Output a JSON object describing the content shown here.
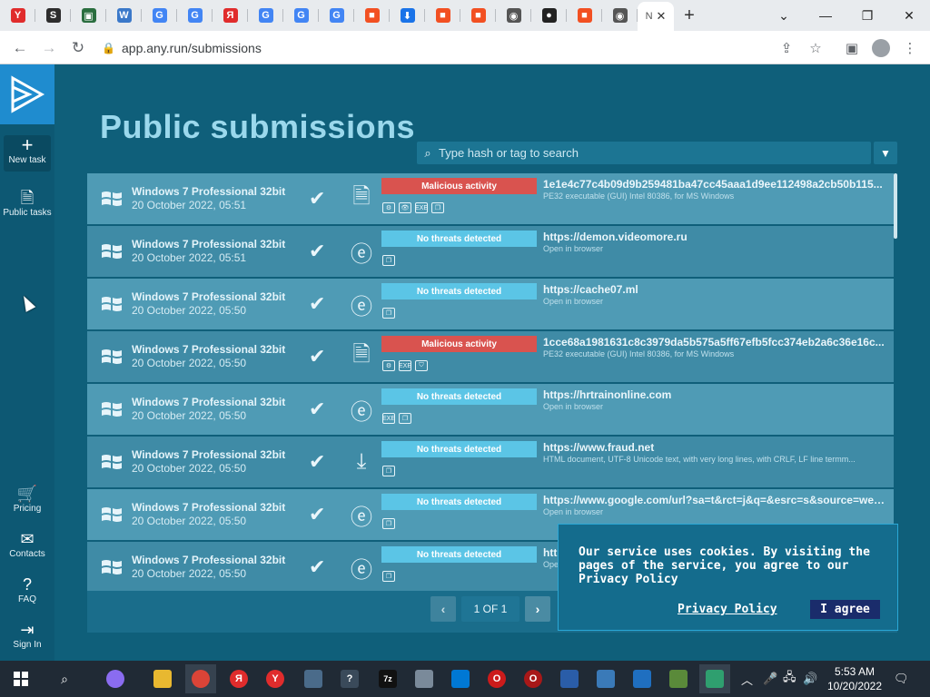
{
  "browser": {
    "tabs": [
      {
        "icon": "yandex-icon",
        "glyph": "Y",
        "color": "#e02c2c"
      },
      {
        "icon": "s-icon",
        "glyph": "S",
        "color": "#2d2d2d"
      },
      {
        "icon": "image-icon",
        "glyph": "▣",
        "color": "#2a6e3f"
      },
      {
        "icon": "wikipedia-icon",
        "glyph": "W",
        "color": "#3a78c9"
      },
      {
        "icon": "google-icon",
        "glyph": "G",
        "color": "#4285f4"
      },
      {
        "icon": "google-icon",
        "glyph": "G",
        "color": "#4285f4"
      },
      {
        "icon": "yandex-icon",
        "glyph": "Я",
        "color": "#e02c2c"
      },
      {
        "icon": "google-icon",
        "glyph": "G",
        "color": "#4285f4"
      },
      {
        "icon": "google-icon",
        "glyph": "G",
        "color": "#4285f4"
      },
      {
        "icon": "google-icon",
        "glyph": "G",
        "color": "#4285f4"
      },
      {
        "icon": "microsoft-icon",
        "glyph": "■",
        "color": "#f25022"
      },
      {
        "icon": "download-icon",
        "glyph": "⬇",
        "color": "#1a73e8"
      },
      {
        "icon": "microsoft-icon",
        "glyph": "■",
        "color": "#f25022"
      },
      {
        "icon": "microsoft-icon",
        "glyph": "■",
        "color": "#f25022"
      },
      {
        "icon": "chrome-icon",
        "glyph": "◉",
        "color": "#555"
      },
      {
        "icon": "github-icon",
        "glyph": "●",
        "color": "#222"
      },
      {
        "icon": "microsoft-icon",
        "glyph": "■",
        "color": "#f25022"
      },
      {
        "icon": "chrome-icon",
        "glyph": "◉",
        "color": "#555"
      }
    ],
    "active_tab_glyph": "N",
    "url": "app.any.run/submissions"
  },
  "sidebar": {
    "new_task": "New task",
    "public_tasks": "Public tasks",
    "pricing": "Pricing",
    "contacts": "Contacts",
    "faq": "FAQ",
    "sign_in": "Sign In"
  },
  "page": {
    "title": "Public submissions",
    "search_placeholder": "Type hash or tag to search"
  },
  "submissions": [
    {
      "os": "Windows 7 Professional 32bit",
      "date": "20 October 2022, 05:51",
      "type": "file",
      "verdict": "Malicious activity",
      "verdict_kind": "bad",
      "object": "1e1e4c77c4b09d9b259481ba47cc45aaa1d9ee112498a2cb50b115...",
      "detail": "PE32 executable (GUI) Intel 80386, for MS Windows",
      "tags": [
        "⚙",
        "👁",
        "EXE",
        "❐"
      ]
    },
    {
      "os": "Windows 7 Professional 32bit",
      "date": "20 October 2022, 05:51",
      "type": "ie",
      "verdict": "No threats detected",
      "verdict_kind": "good",
      "object": "https://demon.videomore.ru",
      "detail": "Open in browser",
      "tags": [
        "❐"
      ]
    },
    {
      "os": "Windows 7 Professional 32bit",
      "date": "20 October 2022, 05:50",
      "type": "ie",
      "verdict": "No threats detected",
      "verdict_kind": "good",
      "object": "https://cache07.ml",
      "detail": "Open in browser",
      "tags": [
        "❐"
      ]
    },
    {
      "os": "Windows 7 Professional 32bit",
      "date": "20 October 2022, 05:50",
      "type": "file",
      "verdict": "Malicious activity",
      "verdict_kind": "bad",
      "object": "1cce68a1981631c8c3979da5b575a5ff67efb5fcc374eb2a6c36e16c...",
      "detail": "PE32 executable (GUI) Intel 80386, for MS Windows",
      "tags": [
        "⚙",
        "EXE",
        "⛉"
      ]
    },
    {
      "os": "Windows 7 Professional 32bit",
      "date": "20 October 2022, 05:50",
      "type": "ie",
      "verdict": "No threats detected",
      "verdict_kind": "good",
      "object": "https://hrtrainonline.com",
      "detail": "Open in browser",
      "tags": [
        "EXE",
        "❐"
      ]
    },
    {
      "os": "Windows 7 Professional 32bit",
      "date": "20 October 2022, 05:50",
      "type": "download",
      "verdict": "No threats detected",
      "verdict_kind": "good",
      "object": "https://www.fraud.net",
      "detail": "HTML document, UTF-8 Unicode text, with very long lines, with CRLF, LF line termm...",
      "tags": [
        "❐"
      ]
    },
    {
      "os": "Windows 7 Professional 32bit",
      "date": "20 October 2022, 05:50",
      "type": "ie",
      "verdict": "No threats detected",
      "verdict_kind": "good",
      "object": "https://www.google.com/url?sa=t&rct=j&q=&esrc=s&source=web&c...",
      "detail": "Open in browser",
      "tags": [
        "❐"
      ]
    },
    {
      "os": "Windows 7 Professional 32bit",
      "date": "20 October 2022, 05:50",
      "type": "ie",
      "verdict": "No threats detected",
      "verdict_kind": "good",
      "object": "https://",
      "detail": "Ope",
      "tags": [
        "❐"
      ]
    }
  ],
  "pagination": {
    "label": "1 OF 1",
    "prev": "‹",
    "next": "›"
  },
  "cookie": {
    "text": "Our service uses cookies. By visiting the pages of the service, you agree to our Privacy Policy",
    "link": "Privacy Policy",
    "button": "I agree"
  },
  "taskbar": {
    "time": "5:53 AM",
    "date": "10/20/2022"
  }
}
